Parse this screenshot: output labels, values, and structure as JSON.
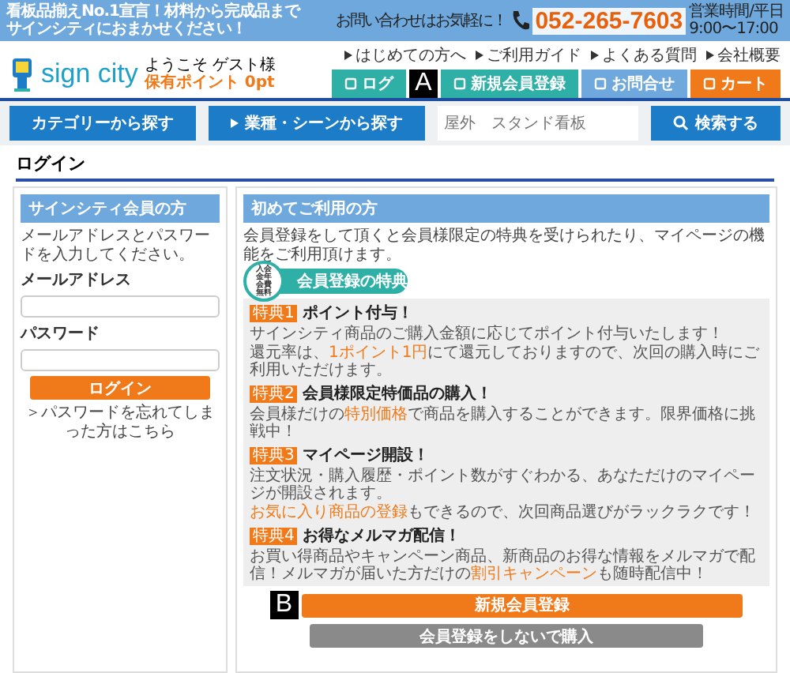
{
  "top_bar": {
    "tagline": [
      "看板品揃えNo.1宣言！材料から完成品まで",
      "サインシティにおまかせください！"
    ],
    "contact_label": "お問い合わせはお気軽に！",
    "phone": "052-265-7603",
    "hours": [
      "営業時間/平日",
      "9:00〜17:00"
    ]
  },
  "header": {
    "logo": "sign city",
    "welcome": "ようこそ ゲスト様",
    "points": "保有ポイント 0pt",
    "links": [
      "はじめての方へ",
      "ご利用ガイド",
      "よくある質問",
      "会社概要"
    ],
    "tabs": [
      {
        "label": "ログ",
        "kind": "login",
        "annotation": "A"
      },
      {
        "label": "新規会員登録",
        "kind": "register"
      },
      {
        "label": "お問合せ",
        "kind": "contact"
      },
      {
        "label": "カート",
        "kind": "cart"
      }
    ]
  },
  "nav": {
    "buttons": [
      {
        "label": "カテゴリーから探す",
        "kind": "plain"
      },
      {
        "label": "業種・シーンから探す",
        "kind": "arrow"
      }
    ],
    "search": {
      "placeholder": "屋外　スタンド看板"
    },
    "search_button": "検索する"
  },
  "page_title": "ログイン",
  "member": {
    "heading": "サインシティ会員の方",
    "intro": "メールアドレスとパスワードを入力してください。",
    "fields": [
      {
        "label": "メールアドレス"
      },
      {
        "label": "パスワード"
      }
    ],
    "login_button": "ログイン",
    "forgot_link": "＞パスワードを忘れてしまった方はこちら"
  },
  "newcomer": {
    "heading": "初めてご利用の方",
    "intro": "会員登録をして頂くと会員様限定の特典を受けられたり、マイページの機能をご利用頂けます。",
    "badge": "入会金年会費無料",
    "benefits_title": "会員登録の特典",
    "benefits": [
      {
        "tag": "特典1",
        "title": "ポイント付与！",
        "lines": [
          "サインシティ商品のご購入金額に応じてポイント付与いたします！",
          "還元率は、**1ポイント1円**にて還元しておりますので、次回の購入時にご利用いただけます。"
        ]
      },
      {
        "tag": "特典2",
        "title": "会員様限定特価品の購入！",
        "lines": [
          "会員様だけの**特別価格**で商品を購入することができます。限界価格に挑戦中！"
        ]
      },
      {
        "tag": "特典3",
        "title": "マイページ開設！",
        "lines": [
          "注文状況・購入履歴・ポイント数がすぐわかる、あなただけのマイページが開設されます。",
          "**お気に入り商品の登録**もできるので、次回商品選びがラックラクです！"
        ]
      },
      {
        "tag": "特典4",
        "title": "お得なメルマガ配信！",
        "lines": [
          "お買い得商品やキャンペーン商品、新商品のお得な情報をメルマガで配信！メルマガが届いた方だけの**割引キャンペーン**も随時配信中！"
        ]
      }
    ],
    "register_button": {
      "label": "新規会員登録",
      "annotation": "B"
    },
    "guest_button": "会員登録をしないで購入"
  }
}
